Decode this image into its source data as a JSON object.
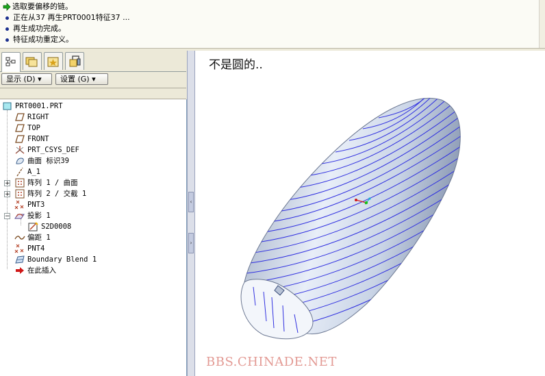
{
  "messages": [
    {
      "icon": "green-arrow-icon",
      "text": "选取要偏移的链。"
    },
    {
      "icon": "bullet-icon",
      "text": "正在从37 再生PRT0001特征37 ..."
    },
    {
      "icon": "bullet-icon",
      "text": "再生成功完成。"
    },
    {
      "icon": "bullet-icon",
      "text": "特征成功重定义。"
    }
  ],
  "navigator": {
    "tabs": [
      "model-tree-tab",
      "folder-browser-tab",
      "favorites-tab",
      "connections-tab"
    ],
    "show_button": "显示 (D)",
    "settings_button": "设置 (G)"
  },
  "tree": {
    "root": "PRT0001.PRT",
    "items": [
      {
        "label": "RIGHT",
        "icon": "datum-plane-icon"
      },
      {
        "label": "TOP",
        "icon": "datum-plane-icon"
      },
      {
        "label": "FRONT",
        "icon": "datum-plane-icon"
      },
      {
        "label": "PRT_CSYS_DEF",
        "icon": "csys-icon"
      },
      {
        "label": "曲面 标识39",
        "icon": "surface-icon"
      },
      {
        "label": "A_1",
        "icon": "axis-icon"
      },
      {
        "label": "阵列 1 / 曲面",
        "icon": "pattern-icon"
      },
      {
        "label": "阵列 2 / 交截 1",
        "icon": "pattern-icon"
      },
      {
        "label": "PNT3",
        "icon": "datum-point-icon"
      },
      {
        "label": "投影 1",
        "icon": "projection-icon"
      },
      {
        "label": "S2D0008",
        "icon": "sketch-icon"
      },
      {
        "label": "偏距 1",
        "icon": "offset-curve-icon"
      },
      {
        "label": "PNT4",
        "icon": "datum-point-icon"
      },
      {
        "label": "Boundary Blend 1",
        "icon": "boundary-blend-icon"
      },
      {
        "label": "在此插入",
        "icon": "insert-here-arrow-icon"
      }
    ]
  },
  "graphics": {
    "title": "不是圆的..",
    "watermark": "BBS.CHINADE.NET"
  },
  "colors": {
    "curve": "#2f2fe0",
    "surface": "#c8d3e6",
    "background": "#ece9d8",
    "watermark": "#e39a94"
  }
}
